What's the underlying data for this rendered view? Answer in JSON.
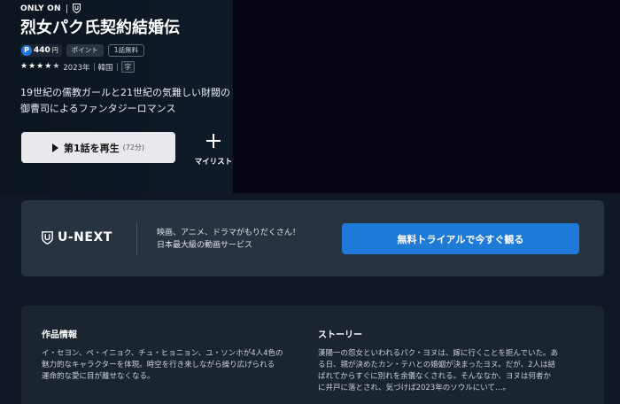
{
  "brand": {
    "only_on": "ONLY ON"
  },
  "title": "烈女パク氏契約結婚伝",
  "badges": {
    "points_value": "440",
    "points_unit": "円",
    "points_coin": "P",
    "point_tag": "ポイント",
    "free_tag": "1話無料"
  },
  "meta": {
    "rating": 4.5,
    "year": "2023年",
    "country": "韓国",
    "subtitle": "字"
  },
  "description": {
    "line1": "19世紀の儒教ガールと21世紀の気難しい財閥の",
    "line2": "御曹司によるファンタジーロマンス"
  },
  "actions": {
    "play_label": "第1話を再生",
    "play_duration": "(72分)",
    "mylist_label": "マイリスト"
  },
  "promo": {
    "logo_text": "U-NEXT",
    "line1": "映画、アニメ、ドラマがもりだくさん！",
    "line2": "日本最大級の動画サービス",
    "button_label": "無料トライアルで今すぐ観る"
  },
  "info": {
    "work_heading": "作品情報",
    "work_line1": "イ・セヨン、ペ・イニョク、チュ・ヒョニョン、ユ・ソンホが4人4色の",
    "work_line2": "魅力的なキャラクターを体現。時空を行き来しながら繰り広げられる",
    "work_line3": "運命的な愛に目が離せなくなる。",
    "story_heading": "ストーリー",
    "story_line1": "漢陽一の怨女といわれるパク・ヨヌは、嫁に行くことを拒んでいた。あ",
    "story_line2": "る日、親が決めたカン・テハとの婚姻が決まったヨヌ。だが、2人は結",
    "story_line3": "ばれてからすぐに別れを余儀なくされる。そんななか、ヨヌは何者か",
    "story_line4": "に井戸に落とされ、気づけば2023年のソウルにいて…。"
  },
  "colors": {
    "accent": "#1e7ad7",
    "background": "#0f1824",
    "promo_bg": "#283340",
    "info_bg": "#1b2530"
  }
}
